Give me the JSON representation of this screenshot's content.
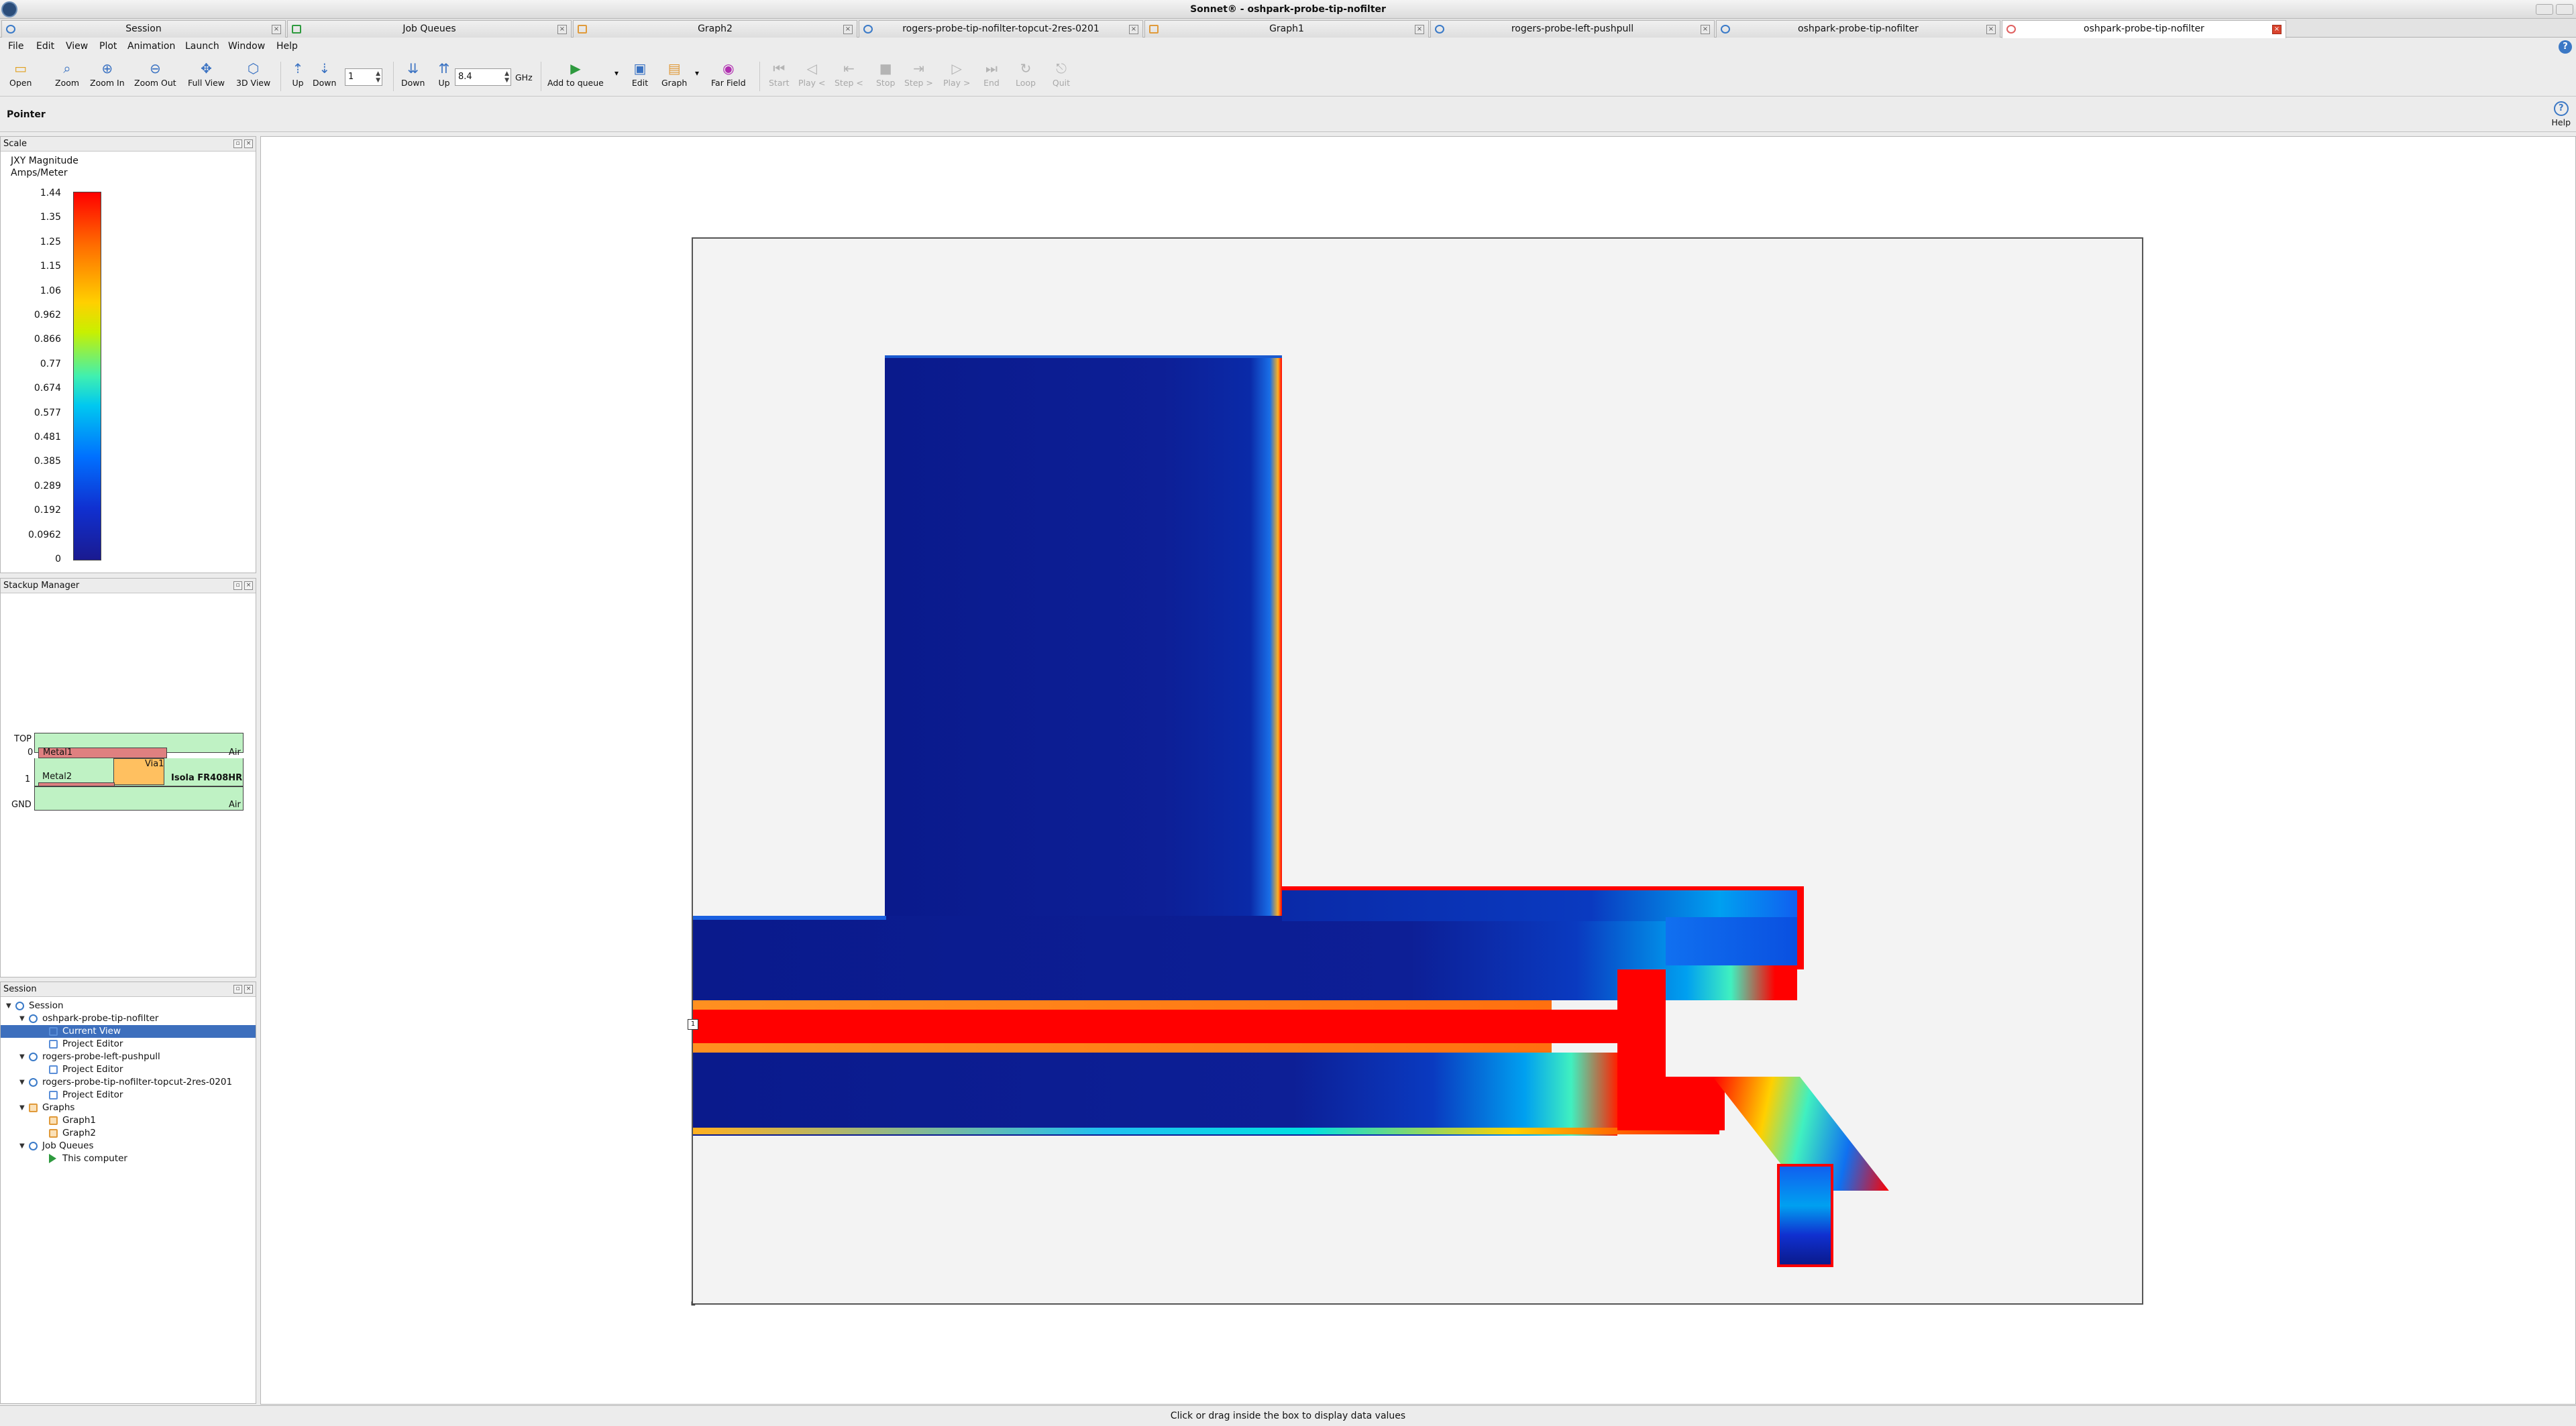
{
  "window": {
    "title": "Sonnet® - oshpark-probe-tip-nofilter"
  },
  "tabs": [
    {
      "label": "Session",
      "icon": "session-icon",
      "active": false
    },
    {
      "label": "Job Queues",
      "icon": "job-queue-icon",
      "active": false
    },
    {
      "label": "Graph2",
      "icon": "graph-icon",
      "active": false
    },
    {
      "label": "rogers-probe-tip-nofilter-topcut-2res-0201",
      "icon": "project-editor-icon",
      "active": false
    },
    {
      "label": "Graph1",
      "icon": "graph-icon",
      "active": false
    },
    {
      "label": "rogers-probe-left-pushpull",
      "icon": "project-editor-icon",
      "active": false
    },
    {
      "label": "oshpark-probe-tip-nofilter",
      "icon": "project-editor-icon",
      "active": false
    },
    {
      "label": "oshpark-probe-tip-nofilter",
      "icon": "current-view-icon",
      "active": true
    }
  ],
  "menu": [
    "File",
    "Edit",
    "View",
    "Plot",
    "Animation",
    "Launch",
    "Window",
    "Help"
  ],
  "toolbar": {
    "open": "Open",
    "zoom": "Zoom",
    "zoom_in": "Zoom In",
    "zoom_out": "Zoom Out",
    "full_view": "Full View",
    "view_3d": "3D View",
    "level_up": "Up",
    "level_down": "Down",
    "level_value": "1",
    "freq_down": "Down",
    "freq_up": "Up",
    "freq_value": "8.4",
    "freq_unit": "GHz",
    "add_to_queue": "Add to queue",
    "edit": "Edit",
    "graph": "Graph",
    "far_field": "Far Field",
    "start": "Start",
    "play_back": "Play <",
    "step_back": "Step <",
    "stop": "Stop",
    "step_fwd": "Step >",
    "play_fwd": "Play >",
    "end": "End",
    "loop": "Loop",
    "quit": "Quit"
  },
  "pointer": {
    "label": "Pointer",
    "help": "Help"
  },
  "scale": {
    "panel_title": "Scale",
    "quantity": "JXY Magnitude",
    "units": "Amps/Meter",
    "ticks": [
      "1.44",
      "1.35",
      "1.25",
      "1.15",
      "1.06",
      "0.962",
      "0.866",
      "0.77",
      "0.674",
      "0.577",
      "0.481",
      "0.385",
      "0.289",
      "0.192",
      "0.0962",
      "0"
    ]
  },
  "stackup": {
    "panel_title": "Stackup Manager",
    "top_label": "TOP",
    "gnd_label": "GND",
    "level0": "0",
    "level1": "1",
    "metal1": "Metal1",
    "metal2": "Metal2",
    "via1": "Via1",
    "dielectric": "Isola FR408HR",
    "air_top": "Air",
    "air_mid": "Air",
    "air_bot": "Air"
  },
  "session": {
    "panel_title": "Session",
    "items": [
      {
        "label": "Session",
        "depth": 0,
        "icon": "session-icon",
        "selected": false
      },
      {
        "label": "oshpark-probe-tip-nofilter",
        "depth": 1,
        "icon": "project-icon",
        "selected": false
      },
      {
        "label": "Current View",
        "depth": 2,
        "icon": "current-view-icon",
        "selected": true
      },
      {
        "label": "Project Editor",
        "depth": 2,
        "icon": "project-editor-icon",
        "selected": false
      },
      {
        "label": "rogers-probe-left-pushpull",
        "depth": 1,
        "icon": "project-icon",
        "selected": false
      },
      {
        "label": "Project Editor",
        "depth": 2,
        "icon": "project-editor-icon",
        "selected": false
      },
      {
        "label": "rogers-probe-tip-nofilter-topcut-2res-0201",
        "depth": 1,
        "icon": "project-icon",
        "selected": false
      },
      {
        "label": "Project Editor",
        "depth": 2,
        "icon": "project-editor-icon",
        "selected": false
      },
      {
        "label": "Graphs",
        "depth": 1,
        "icon": "graph-icon",
        "selected": false
      },
      {
        "label": "Graph1",
        "depth": 2,
        "icon": "graph-icon",
        "selected": false
      },
      {
        "label": "Graph2",
        "depth": 2,
        "icon": "graph-icon",
        "selected": false
      },
      {
        "label": "Job Queues",
        "depth": 1,
        "icon": "job-queue-icon",
        "selected": false
      },
      {
        "label": "This computer",
        "depth": 2,
        "icon": "queue-run-icon",
        "selected": false
      }
    ]
  },
  "view": {
    "port_label": "1"
  },
  "status": {
    "text": "Click or drag inside the box to display data values"
  },
  "colors": {
    "selection": "#3d6fbd",
    "current_low": "#0a1a8c",
    "current_high": "#ff0000"
  }
}
